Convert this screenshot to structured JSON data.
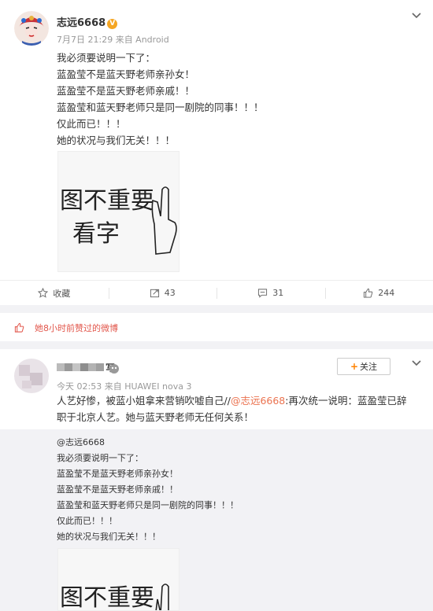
{
  "post1": {
    "username": "志远6668",
    "meta": "7月7日 21:29 来自 Android",
    "lines": [
      "我必须要说明一下了：",
      "蓝盈莹不是蓝天野老师亲孙女！",
      "蓝盈莹不是蓝天野老师亲戚！！",
      "蓝盈莹和蓝天野老师只是同一剧院的同事！！！",
      "仅此而已！！！",
      "她的状况与我们无关！！！"
    ],
    "actions": {
      "favorite": "收藏",
      "repost": "43",
      "comment": "31",
      "like": "244"
    }
  },
  "notice": {
    "text": "她8小时前赞过的微博"
  },
  "post2": {
    "meta": "今天 02:53 来自 HUAWEI nova 3",
    "follow_label": "关注",
    "line1": "人艺好惨，被蓝小姐拿来营销吹嘘自己//",
    "mention": "@志远6668",
    "line1_rest": ":再次统一说明：蓝盈莹已辞",
    "line2": "职于北京人艺。她与蓝天野老师无任何关系！",
    "repost": {
      "author": "@志远6668",
      "lines": [
        "我必须要说明一下了：",
        "蓝盈莹不是蓝天野老师亲孙女！",
        "蓝盈莹不是蓝天野老师亲戚！！",
        "蓝盈莹和蓝天野老师只是同一剧院的同事！！！",
        "仅此而已！！！",
        "她的状况与我们无关！！！"
      ]
    }
  },
  "meme": {
    "line1": "图不重要",
    "line2": "看字"
  },
  "colors": {
    "accent": "#ff8200",
    "mention": "#eb7350",
    "notice": "#e2574c",
    "vip": "#f5a623"
  }
}
